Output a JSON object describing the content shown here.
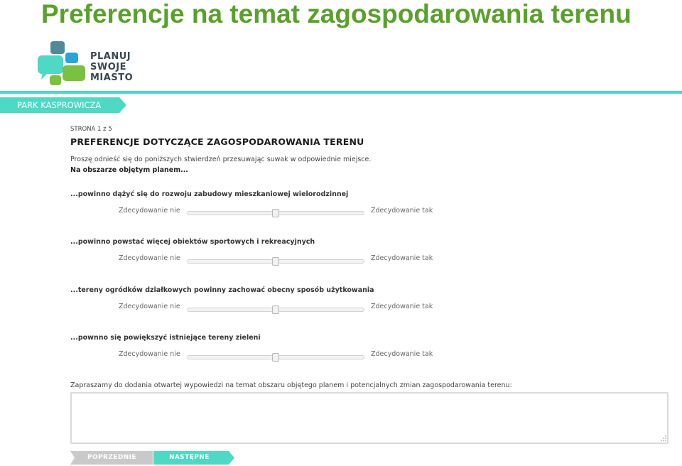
{
  "slide_title": "Preferencje na temat zagospodarowania terenu",
  "logo": {
    "line1": "PLANUJ",
    "line2": "SWOJE",
    "line3": "MIASTO",
    "icon": "speech-bubbles-logo"
  },
  "colors": {
    "title_green": "#5aa02c",
    "accent_teal": "#4fd8c4",
    "button_grey": "#c9c9c9"
  },
  "ribbon": {
    "label": "PARK KASPROWICZA"
  },
  "survey": {
    "page_indicator": "STRONA 1 z 5",
    "section_title": "PREFERENCJE DOTYCZĄCE ZAGOSPODAROWANIA TERENU",
    "instruction": "Proszę odnieść się do poniższych stwierdzeń przesuwając suwak w odpowiednie miejsce.",
    "context": "Na obszarze objętym planem...",
    "questions": [
      {
        "label": "...powinno dążyć się do rozwoju zabudowy mieszkaniowej wielorodzinnej",
        "min_label": "Zdecydowanie nie",
        "max_label": "Zdecydowanie tak",
        "value": 0.5
      },
      {
        "label": "...powinno powstać więcej obiektów sportowych i rekreacyjnych",
        "min_label": "Zdecydowanie nie",
        "max_label": "Zdecydowanie tak",
        "value": 0.5
      },
      {
        "label": "...tereny ogródków działkowych powinny zachować obecny sposób użytkowania",
        "min_label": "Zdecydowanie nie",
        "max_label": "Zdecydowanie tak",
        "value": 0.5
      },
      {
        "label": "...pownno się powiększyć istniejące tereny zieleni",
        "min_label": "Zdecydowanie nie",
        "max_label": "Zdecydowanie tak",
        "value": 0.5
      }
    ],
    "comment": {
      "label": "Zapraszamy do dodania otwartej wypowiedzi na temat obszaru objętego planem i potencjalnych zmian zagospodarowania terenu:",
      "value": ""
    }
  },
  "nav": {
    "prev_label": "POPRZEDNIE",
    "next_label": "NASTĘPNE"
  }
}
